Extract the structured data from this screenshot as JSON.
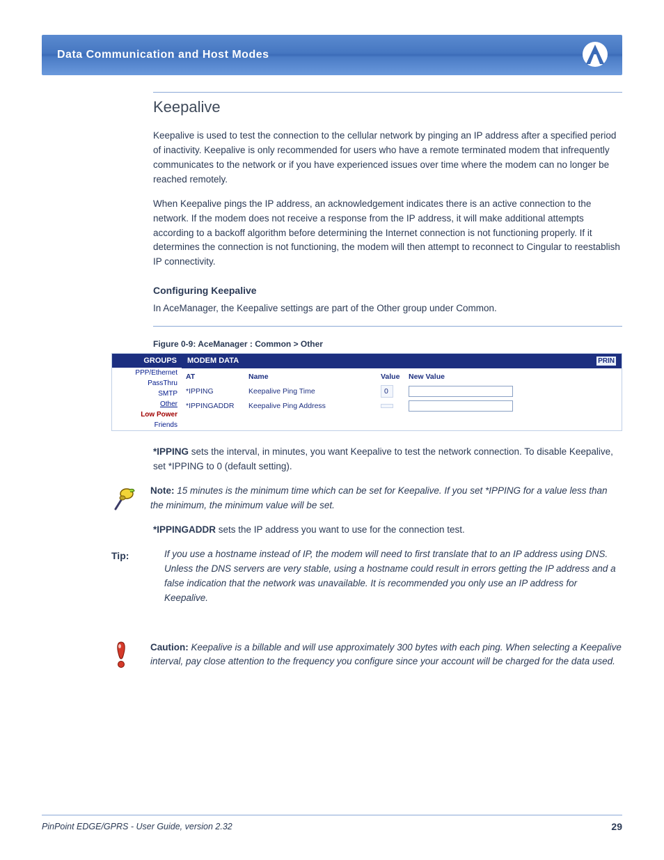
{
  "header": {
    "title": "Data Communication and Host Modes"
  },
  "section": {
    "title": "Keepalive"
  },
  "intro": [
    "Keepalive is used to test the connection to the cellular network by pinging an IP address after a specified period of inactivity. Keepalive is only recommended for users who have a remote terminated modem that infrequently communicates to the network or if you have experienced issues over time where the modem can no longer be reached remotely.",
    "When Keepalive pings the IP address, an acknowledgement indicates there is an active connection to the network. If the modem does not receive a response from the IP address, it will make additional attempts according to a backoff algorithm before determining the Internet connection is not functioning properly. If it determines the connection is not functioning, the modem will then attempt to reconnect to Cingular to reestablish IP connectivity."
  ],
  "config_heading": "Configuring Keepalive",
  "config_body": "In AceManager, the Keepalive settings are part of the Other group under Common.",
  "figure_caption": "Figure 0-9: AceManager : Common > Other",
  "app": {
    "groups_header": "GROUPS",
    "main_header": "MODEM DATA",
    "print": "PRIN",
    "groups": [
      {
        "label": "PPP/Ethernet",
        "cls": ""
      },
      {
        "label": "PassThru",
        "cls": ""
      },
      {
        "label": "SMTP",
        "cls": ""
      },
      {
        "label": "Other",
        "cls": "link"
      },
      {
        "label": "Low Power",
        "cls": "bold"
      },
      {
        "label": "Friends",
        "cls": ""
      }
    ],
    "columns": {
      "at": "AT",
      "name": "Name",
      "value": "Value",
      "new_value": "New Value"
    },
    "rows": [
      {
        "at": "*IPPING",
        "name": "Keepalive Ping Time",
        "value": "0"
      },
      {
        "at": "*IPPINGADDR",
        "name": "Keepalive Ping Address",
        "value": ""
      }
    ]
  },
  "ipping": {
    "heading": "*IPPING",
    "text": " sets the interval, in minutes, you want Keepalive to test the network connection. To disable Keepalive, set *IPPING to 0 (default setting)."
  },
  "note": {
    "label": "Note:",
    "text": " 15 minutes is the minimum time which can be set for Keepalive. If you set *IPPING for a value less than the minimum, the minimum value will be set."
  },
  "ippingaddr": {
    "heading": "*IPPINGADDR",
    "text": " sets the IP address you want to use for the connection test."
  },
  "tip": {
    "label": "Tip:",
    "text": " If you use a hostname instead of IP, the modem will need to first translate that to an IP address using DNS. Unless the DNS servers are very stable, using a hostname could result in errors getting the IP address and a false indication that the network was unavailable. It is recommended you only use an IP address for Keepalive."
  },
  "caution": {
    "label": "Caution:",
    "text": " Keepalive is a billable and will use approximately 300 bytes with each ping. When selecting a Keepalive interval, pay close attention to the frequency you configure since your account will be charged for the data used."
  },
  "footer": {
    "left": "PinPoint EDGE/GPRS - User Guide, version 2.32",
    "right": "29"
  }
}
